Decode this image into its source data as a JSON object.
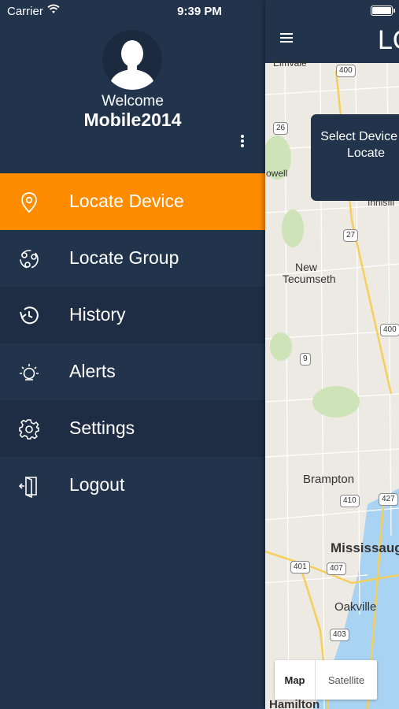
{
  "status_bar": {
    "carrier": "Carrier",
    "time": "9:39 PM"
  },
  "profile": {
    "welcome": "Welcome",
    "username": "Mobile2014"
  },
  "menu": [
    {
      "label": "Locate Device",
      "icon": "location-pin-icon"
    },
    {
      "label": "Locate Group",
      "icon": "group-locations-icon"
    },
    {
      "label": "History",
      "icon": "history-icon"
    },
    {
      "label": "Alerts",
      "icon": "alert-bulb-icon"
    },
    {
      "label": "Settings",
      "icon": "gear-icon"
    },
    {
      "label": "Logout",
      "icon": "logout-door-icon"
    }
  ],
  "colors": {
    "drawer_bg": "#22344c",
    "active_bg": "#ff8c00",
    "shaded_row": "#1e2d44",
    "water": "#a9d3f2"
  },
  "header": {
    "title": "LO"
  },
  "map": {
    "tooltip": "Select Device to Locate",
    "places": [
      "Elmvale",
      "Innisfil",
      "New Tecumseth",
      "Brampton",
      "Mississauga",
      "Oakville",
      "Hamilton",
      "owell"
    ],
    "highways": [
      "400",
      "26",
      "27",
      "9",
      "400",
      "410",
      "427",
      "401",
      "407",
      "403"
    ],
    "type_buttons": {
      "map": "Map",
      "satellite": "Satellite"
    }
  }
}
